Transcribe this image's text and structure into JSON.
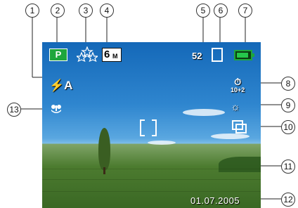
{
  "display": {
    "mode_badge": "P",
    "quality_icon": "quality-stars-icon",
    "resolution": {
      "big": "6",
      "small": "M"
    },
    "shots_remaining": "52",
    "memory_icon": "sd-card-icon",
    "battery_icon": "battery-full-icon",
    "flash_mode": "⚡A",
    "macro_icon": "macro-flower-icon",
    "self_timer": {
      "symbol": "⏱",
      "label": "10+2"
    },
    "white_balance_icon": "sun-icon",
    "white_balance_symbol": "☼",
    "burst_icon": "burst-mode-icon",
    "date": "01.07.2005"
  },
  "callouts": [
    "1",
    "2",
    "3",
    "4",
    "5",
    "6",
    "7",
    "8",
    "9",
    "10",
    "11",
    "12",
    "13"
  ],
  "colors": {
    "mode_green": "#1ea63c",
    "battery_green": "#25c64b",
    "sky": "#2f86cf",
    "field": "#4c7b2f"
  }
}
